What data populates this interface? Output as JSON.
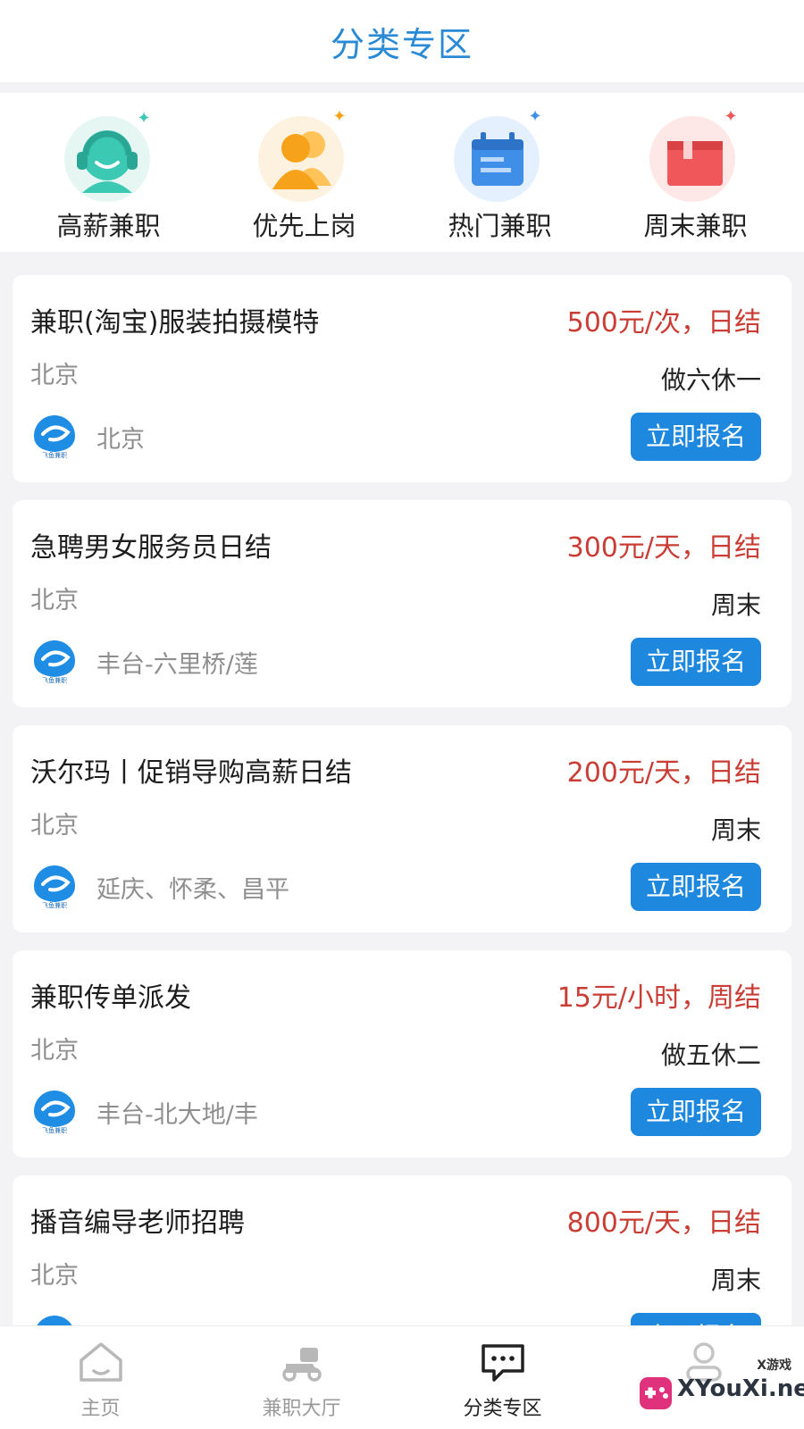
{
  "header": {
    "title": "分类专区"
  },
  "categories": [
    {
      "label": "高薪兼职",
      "icon": "headset-person-icon",
      "color": "#3cc9b4"
    },
    {
      "label": "优先上岗",
      "icon": "people-icon",
      "color": "#f7a21b"
    },
    {
      "label": "热门兼职",
      "icon": "calendar-icon",
      "color": "#3f8fe8"
    },
    {
      "label": "周末兼职",
      "icon": "gift-box-icon",
      "color": "#f0575a"
    }
  ],
  "jobs": [
    {
      "title": "兼职(淘宝)服装拍摄模特",
      "salary": "500元/次，日结",
      "city": "北京",
      "schedule": "做六休一",
      "area": "北京",
      "apply": "立即报名"
    },
    {
      "title": "急聘男女服务员日结",
      "salary": "300元/天，日结",
      "city": "北京",
      "schedule": "周末",
      "area": "丰台-六里桥/莲",
      "apply": "立即报名"
    },
    {
      "title": "沃尔玛丨促销导购高薪日结",
      "salary": "200元/天，日结",
      "city": "北京",
      "schedule": "周末",
      "area": "延庆、怀柔、昌平",
      "apply": "立即报名"
    },
    {
      "title": "兼职传单派发",
      "salary": "15元/小时，周结",
      "city": "北京",
      "schedule": "做五休二",
      "area": "丰台-北大地/丰",
      "apply": "立即报名"
    },
    {
      "title": "播音编导老师招聘",
      "salary": "800元/天，日结",
      "city": "北京",
      "schedule": "周末",
      "area": "",
      "apply": "立即报名"
    }
  ],
  "logo": {
    "text": "飞鱼兼职"
  },
  "nav": [
    {
      "label": "主页",
      "icon": "home-icon",
      "active": false
    },
    {
      "label": "兼职大厅",
      "icon": "scooter-icon",
      "active": false
    },
    {
      "label": "分类专区",
      "icon": "message-icon",
      "active": true
    },
    {
      "label": "",
      "icon": "profile-icon",
      "active": false
    }
  ],
  "watermark": {
    "small": "X游戏",
    "text": "XYouXi.net"
  },
  "colors": {
    "accent": "#1d88dd",
    "salary": "#c93d35",
    "title": "#2a8ad6"
  }
}
